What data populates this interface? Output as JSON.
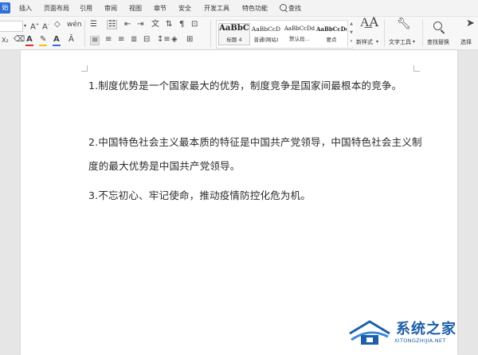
{
  "menu": {
    "active_tab": "始",
    "items": [
      "插入",
      "页面布局",
      "引用",
      "审阅",
      "视图",
      "章节",
      "安全",
      "开发工具",
      "特色功能"
    ],
    "search_label": "查找"
  },
  "ribbon": {
    "styles": [
      {
        "sample": "AaBbC",
        "name": "标题 4"
      },
      {
        "sample": "AaBbCcD",
        "name": "普通(网站)"
      },
      {
        "sample": "AaBbCcDd",
        "name": "默认段..."
      },
      {
        "sample": "AaBbCcDc",
        "name": "要点"
      }
    ],
    "new_style_label": "新样式",
    "text_tools_label": "文字工具",
    "find_replace_label": "查找替换",
    "select_label": "选择"
  },
  "document": {
    "paragraphs": [
      "1.制度优势是一个国家最大的优势，制度竞争是国家间最根本的竞争。",
      "2.中国特色社会主义最本质的特征是中国共产党领导，中国特色社会主义制度的最大优势是中国共产党领导。",
      "3.不忘初心、牢记使命，推动疫情防控化危为机。"
    ]
  },
  "watermark": {
    "title": "系统之家",
    "url": "XITONGZHIJIA.NET",
    "color": "#1e5fa8"
  },
  "colors": {
    "accent": "#2f6fd6",
    "font_color_red": "#d9342b",
    "highlight_yellow": "#f2c21b",
    "font_color_blue": "#2f6fd6"
  }
}
